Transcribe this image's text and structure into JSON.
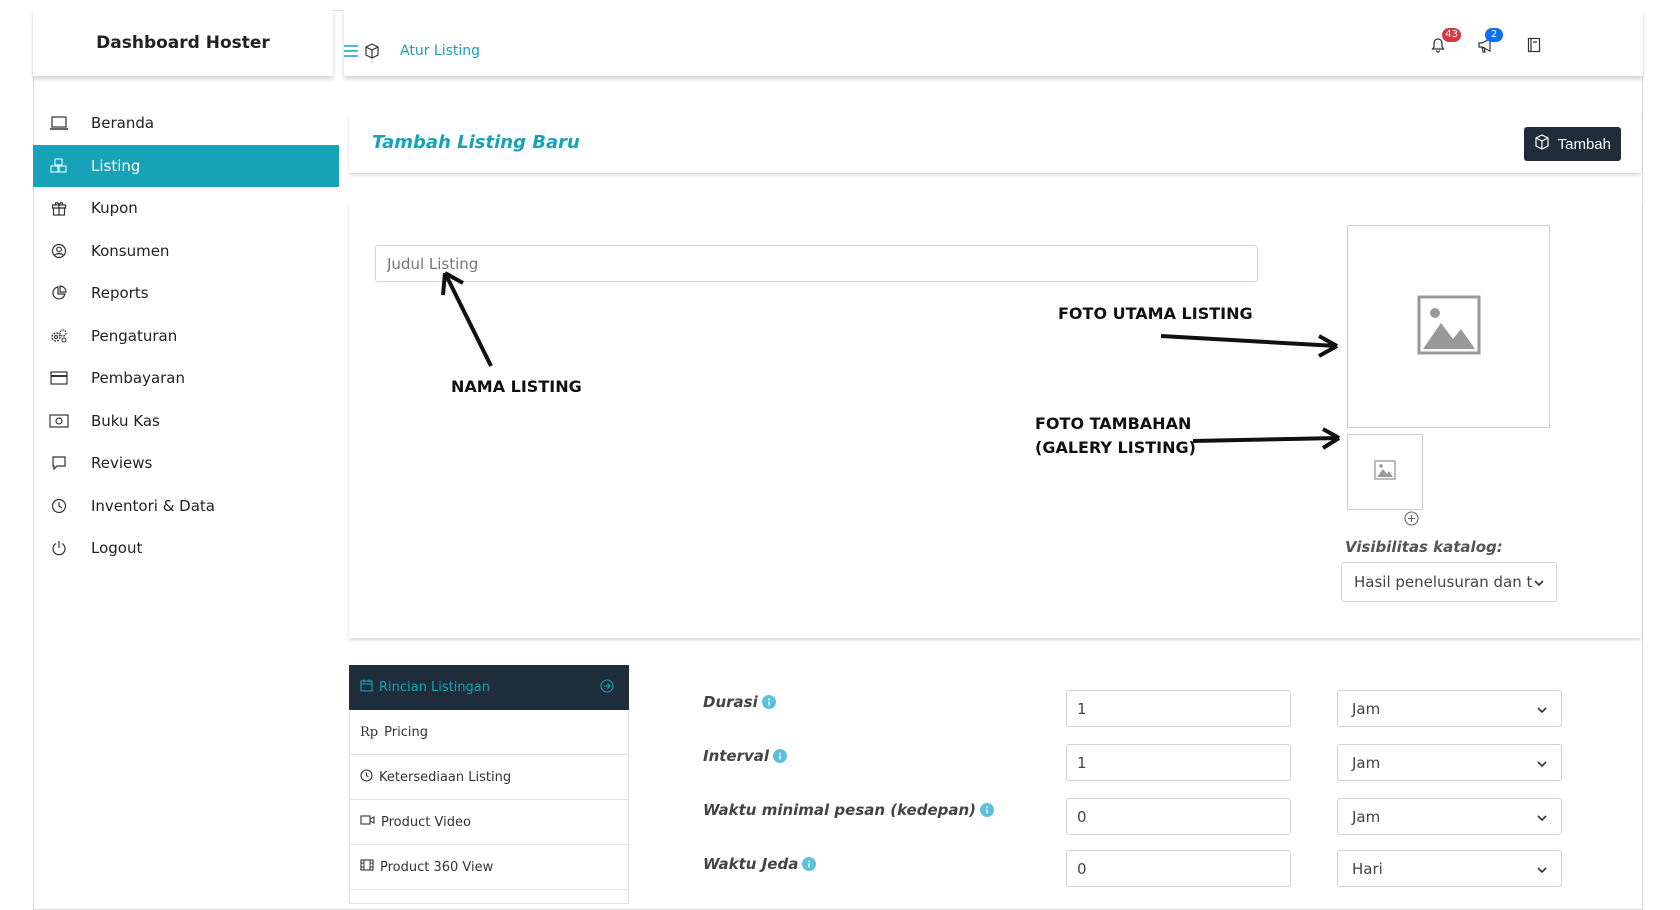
{
  "brand": "Dashboard Hoster",
  "breadcrumb": {
    "label": "Atur Listing"
  },
  "notifications": {
    "bell_count": "43",
    "megaphone_count": "2"
  },
  "sidebar": {
    "items": [
      {
        "label": "Beranda",
        "icon": "laptop-icon"
      },
      {
        "label": "Listing",
        "icon": "boxes-icon",
        "active": true
      },
      {
        "label": "Kupon",
        "icon": "gift-icon"
      },
      {
        "label": "Konsumen",
        "icon": "user-circle-icon"
      },
      {
        "label": "Reports",
        "icon": "pie-chart-icon"
      },
      {
        "label": "Pengaturan",
        "icon": "gears-icon"
      },
      {
        "label": "Pembayaran",
        "icon": "credit-card-icon"
      },
      {
        "label": "Buku Kas",
        "icon": "cash-icon"
      },
      {
        "label": "Reviews",
        "icon": "chat-icon"
      },
      {
        "label": "Inventori & Data",
        "icon": "clock-icon"
      },
      {
        "label": "Logout",
        "icon": "power-icon"
      }
    ]
  },
  "header_card": {
    "title": "Tambah Listing Baru",
    "button_label": "Tambah"
  },
  "listing_form": {
    "title_placeholder": "Judul Listing",
    "annotations": {
      "nama": "NAMA LISTING",
      "foto_utama": "FOTO UTAMA LISTING",
      "foto_tambahan_1": "FOTO TAMBAHAN",
      "foto_tambahan_2": "(GALERY LISTING)"
    },
    "visibility_label": "Visibilitas katalog:",
    "visibility_value": "Hasil penelusuran dan t"
  },
  "tabs": [
    {
      "label": "Rincian Listingan",
      "active": true
    },
    {
      "label": "Pricing",
      "prefix": "Rp"
    },
    {
      "label": "Ketersediaan Listing"
    },
    {
      "label": "Product Video"
    },
    {
      "label": "Product 360 View"
    }
  ],
  "fields": [
    {
      "label": "Durasi",
      "value": "1",
      "unit": "Jam"
    },
    {
      "label": "Interval",
      "value": "1",
      "unit": "Jam"
    },
    {
      "label": "Waktu minimal pesan (kedepan)",
      "value": "0",
      "unit": "Jam"
    },
    {
      "label": "Waktu Jeda",
      "value": "0",
      "unit": "Hari"
    }
  ],
  "colors": {
    "accent": "#17a2b8",
    "dark": "#1f2d3a"
  }
}
